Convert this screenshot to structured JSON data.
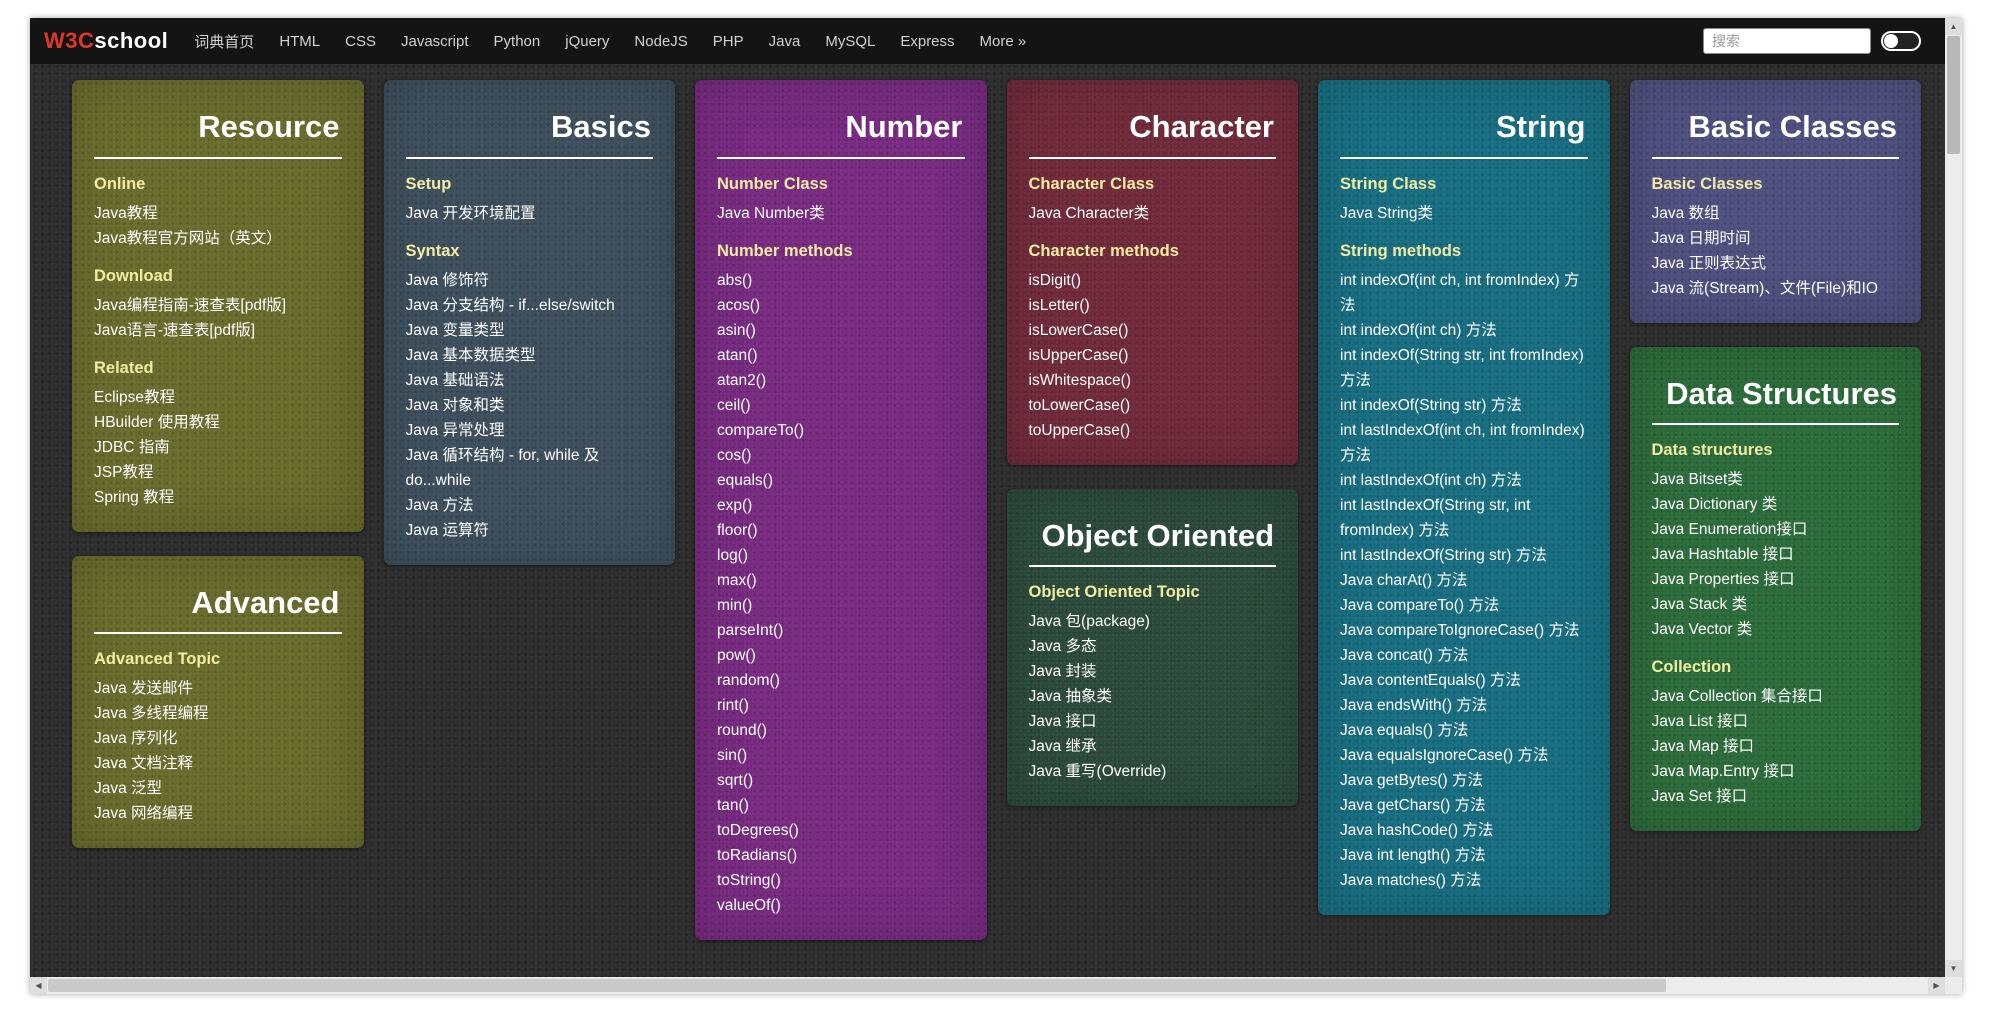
{
  "theme": {
    "navbar_bg": "#141414",
    "logo_accent": "#e0362c",
    "nav_link": "#d2d2d2",
    "page_bg": "#2d2d2d",
    "heading": "#f2eda2",
    "link_text": "#ffffff"
  },
  "navbar": {
    "logo_primary": "W3C",
    "logo_secondary": "school",
    "items": [
      "词典首页",
      "HTML",
      "CSS",
      "Javascript",
      "Python",
      "jQuery",
      "NodeJS",
      "PHP",
      "Java",
      "MySQL",
      "Express",
      "More »"
    ],
    "search_placeholder": "搜索"
  },
  "scrollbar": {
    "up_arrow": "▲",
    "down_arrow": "▼",
    "left_arrow": "◀",
    "right_arrow": "▶"
  },
  "content": {
    "columns": [
      {
        "cards": [
          {
            "title": "Resource",
            "bg": "#696b2d",
            "sections": [
              {
                "heading": "Online",
                "items": [
                  "Java教程",
                  "Java教程官方网站（英文）"
                ]
              },
              {
                "heading": "Download",
                "items": [
                  "Java编程指南-速查表[pdf版]",
                  "Java语言-速查表[pdf版]"
                ]
              },
              {
                "heading": "Related",
                "items": [
                  "Eclipse教程",
                  "HBuilder 使用教程",
                  "JDBC 指南",
                  "JSP教程",
                  "Spring 教程"
                ]
              }
            ]
          },
          {
            "title": "Advanced",
            "bg": "#696b2d",
            "sections": [
              {
                "heading": "Advanced Topic",
                "items": [
                  "Java 发送邮件",
                  "Java 多线程编程",
                  "Java 序列化",
                  "Java 文档注释",
                  "Java 泛型",
                  "Java 网络编程"
                ]
              }
            ]
          }
        ]
      },
      {
        "cards": [
          {
            "title": "Basics",
            "bg": "#3d4e5c",
            "sections": [
              {
                "heading": "Setup",
                "items": [
                  "Java 开发环境配置"
                ]
              },
              {
                "heading": "Syntax",
                "items": [
                  "Java 修饰符",
                  "Java 分支结构 - if...else/switch",
                  "Java 变量类型",
                  "Java 基本数据类型",
                  "Java 基础语法",
                  "Java 对象和类",
                  "Java 异常处理",
                  "Java 循环结构 - for, while 及 do...while",
                  "Java 方法",
                  "Java 运算符"
                ]
              }
            ]
          }
        ]
      },
      {
        "cards": [
          {
            "title": "Number",
            "bg": "#772a80",
            "sections": [
              {
                "heading": "Number Class",
                "items": [
                  "Java Number类"
                ]
              },
              {
                "heading": "Number methods",
                "items": [
                  "abs()",
                  "acos()",
                  "asin()",
                  "atan()",
                  "atan2()",
                  "ceil()",
                  "compareTo()",
                  "cos()",
                  "equals()",
                  "exp()",
                  "floor()",
                  "log()",
                  "max()",
                  "min()",
                  "parseInt()",
                  "pow()",
                  "random()",
                  "rint()",
                  "round()",
                  "sin()",
                  "sqrt()",
                  "tan()",
                  "toDegrees()",
                  "toRadians()",
                  "toString()",
                  "valueOf()"
                ]
              }
            ]
          }
        ]
      },
      {
        "cards": [
          {
            "title": "Character",
            "bg": "#702a3a",
            "sections": [
              {
                "heading": "Character Class",
                "items": [
                  "Java Character类"
                ]
              },
              {
                "heading": "Character methods",
                "items": [
                  "isDigit()",
                  "isLetter()",
                  "isLowerCase()",
                  "isUpperCase()",
                  "isWhitespace()",
                  "toLowerCase()",
                  "toUpperCase()"
                ]
              }
            ]
          },
          {
            "title": "Object Oriented",
            "bg": "#2c4a3b",
            "sections": [
              {
                "heading": "Object Oriented Topic",
                "items": [
                  "Java 包(package)",
                  "Java 多态",
                  "Java 封装",
                  "Java 抽象类",
                  "Java 接口",
                  "Java 继承",
                  "Java 重写(Override)"
                ]
              }
            ]
          }
        ]
      },
      {
        "cards": [
          {
            "title": "String",
            "bg": "#176d80",
            "sections": [
              {
                "heading": "String Class",
                "items": [
                  "Java String类"
                ]
              },
              {
                "heading": "String methods",
                "items": [
                  "int indexOf(int ch, int fromIndex) 方法",
                  "int indexOf(int ch) 方法",
                  "int indexOf(String str, int fromIndex) 方法",
                  "int indexOf(String str) 方法",
                  "int lastIndexOf(int ch, int fromIndex) 方法",
                  "int lastIndexOf(int ch) 方法",
                  "int lastIndexOf(String str, int fromIndex) 方法",
                  "int lastIndexOf(String str) 方法",
                  "Java charAt() 方法",
                  "Java compareTo() 方法",
                  "Java compareToIgnoreCase() 方法",
                  "Java concat() 方法",
                  "Java contentEquals() 方法",
                  "Java endsWith() 方法",
                  "Java equals() 方法",
                  "Java equalsIgnoreCase() 方法",
                  "Java getBytes() 方法",
                  "Java getChars() 方法",
                  "Java hashCode() 方法",
                  "Java int length() 方法",
                  "Java matches() 方法"
                ]
              }
            ]
          }
        ]
      },
      {
        "cards": [
          {
            "title": "Basic Classes",
            "bg": "#4e4f7e",
            "sections": [
              {
                "heading": "Basic Classes",
                "items": [
                  "Java 数组",
                  "Java 日期时间",
                  "Java 正则表达式",
                  "Java 流(Stream)、文件(File)和IO"
                ]
              }
            ]
          },
          {
            "title": "Data Structures",
            "bg": "#2c6b3a",
            "sections": [
              {
                "heading": "Data structures",
                "items": [
                  "Java Bitset类",
                  "Java Dictionary 类",
                  "Java Enumeration接口",
                  "Java Hashtable 接口",
                  "Java Properties 接口",
                  "Java Stack 类",
                  "Java Vector 类"
                ]
              },
              {
                "heading": "Collection",
                "items": [
                  "Java Collection 集合接口",
                  "Java List 接口",
                  "Java Map 接口",
                  "Java Map.Entry 接口",
                  "Java Set 接口"
                ]
              }
            ]
          }
        ]
      }
    ]
  }
}
